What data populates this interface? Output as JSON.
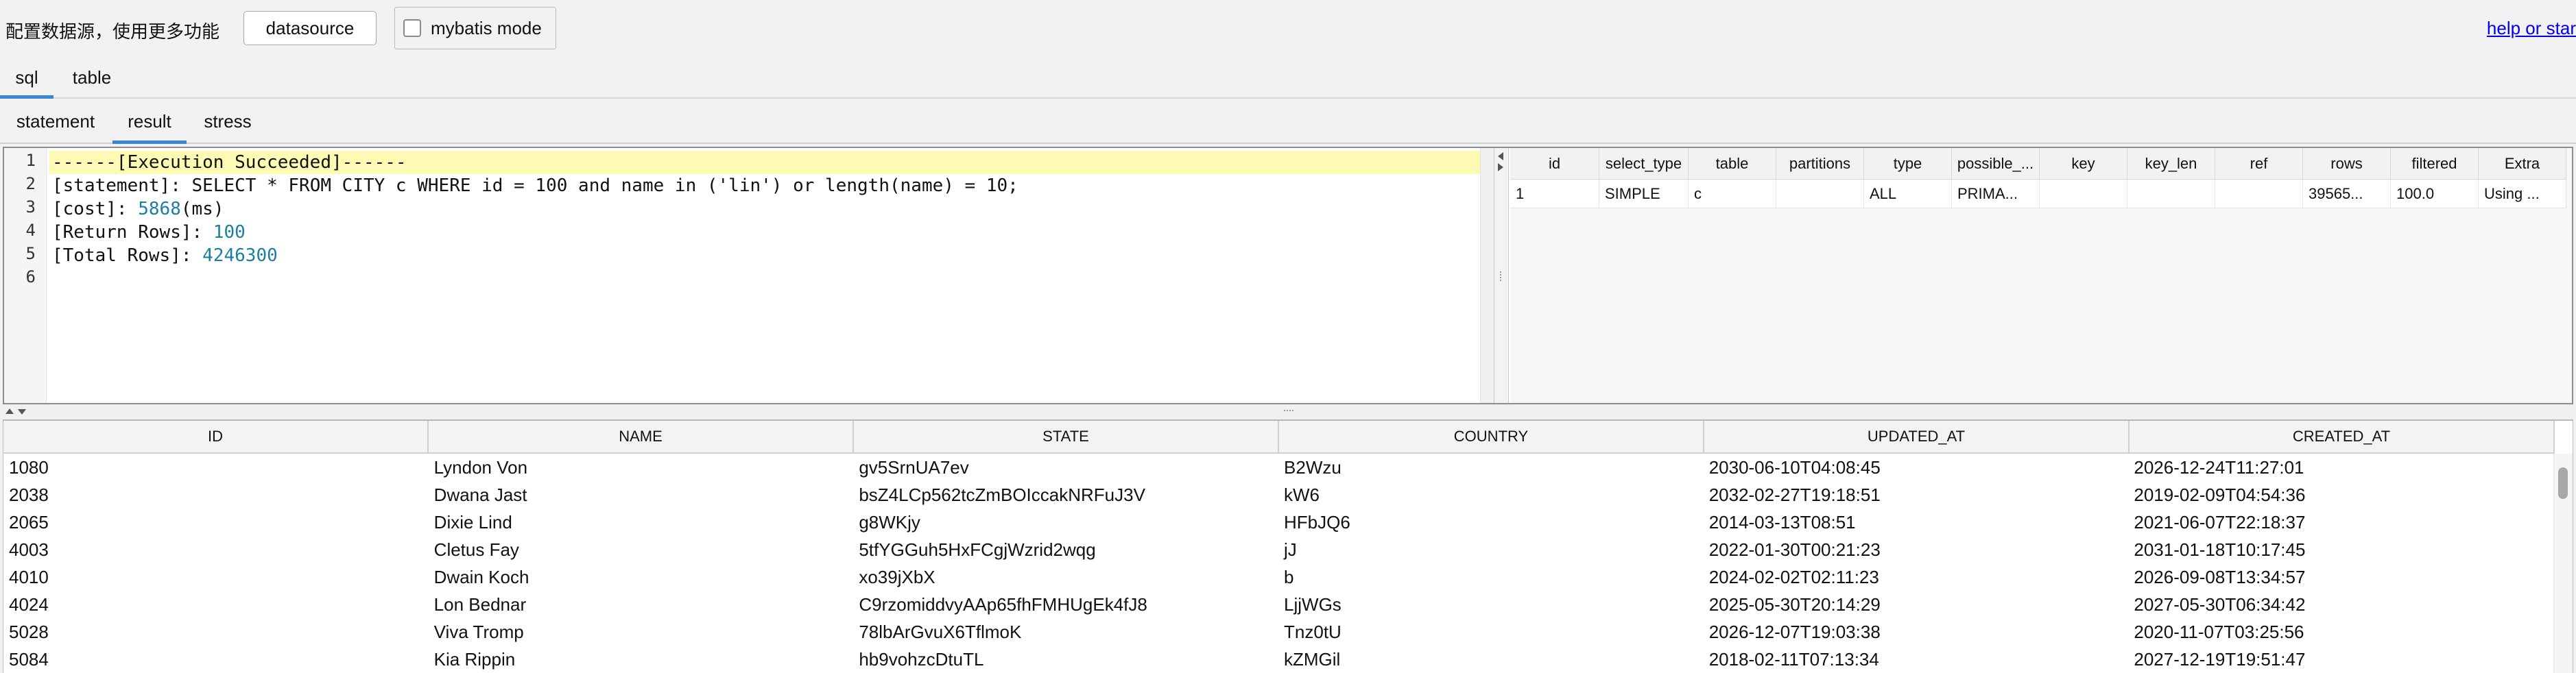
{
  "toolbar": {
    "label": "配置数据源，使用更多功能",
    "datasource_button": "datasource",
    "mybatis_label": "mybatis mode",
    "mybatis_checked": false,
    "help_link": "help or star"
  },
  "tabs_primary": [
    {
      "label": "sql",
      "active": true
    },
    {
      "label": "table",
      "active": false
    }
  ],
  "tabs_secondary": [
    {
      "label": "statement",
      "active": false
    },
    {
      "label": "result",
      "active": true
    },
    {
      "label": "stress",
      "active": false
    }
  ],
  "editor": {
    "line_numbers": [
      "1",
      "2",
      "3",
      "4",
      "5",
      "6"
    ],
    "lines": [
      {
        "key": "",
        "text": "------[Execution Succeeded]------"
      },
      {
        "key": "statement",
        "text": "SELECT * FROM CITY c WHERE id = 100 and name in ('lin') or length(name) = 10;"
      },
      {
        "key": "cost",
        "value": "5868",
        "unit": "(ms)"
      },
      {
        "key": "Return Rows",
        "value": "100"
      },
      {
        "key": "Total Rows",
        "value": "4246300"
      }
    ]
  },
  "explain": {
    "columns": [
      "id",
      "select_type",
      "table",
      "partitions",
      "type",
      "possible_...",
      "key",
      "key_len",
      "ref",
      "rows",
      "filtered",
      "Extra"
    ],
    "rows": [
      [
        "1",
        "SIMPLE",
        "c",
        "",
        "ALL",
        "PRIMA...",
        "",
        "",
        "",
        "39565...",
        "100.0",
        "Using ..."
      ]
    ]
  },
  "result": {
    "columns": [
      "ID",
      "NAME",
      "STATE",
      "COUNTRY",
      "UPDATED_AT",
      "CREATED_AT"
    ],
    "rows": [
      [
        "1080",
        "Lyndon Von",
        "gv5SrnUA7ev",
        "B2Wzu",
        "2030-06-10T04:08:45",
        "2026-12-24T11:27:01"
      ],
      [
        "2038",
        "Dwana Jast",
        "bsZ4LCp562tcZmBOIccakNRFuJ3V",
        "kW6",
        "2032-02-27T19:18:51",
        "2019-02-09T04:54:36"
      ],
      [
        "2065",
        "Dixie Lind",
        "g8WKjy",
        "HFbJQ6",
        "2014-03-13T08:51",
        "2021-06-07T22:18:37"
      ],
      [
        "4003",
        "Cletus Fay",
        "5tfYGGuh5HxFCgjWzrid2wqg",
        "jJ",
        "2022-01-30T00:21:23",
        "2031-01-18T10:17:45"
      ],
      [
        "4010",
        "Dwain Koch",
        "xo39jXbX",
        "b",
        "2024-02-02T02:11:23",
        "2026-09-08T13:34:57"
      ],
      [
        "4024",
        "Lon Bednar",
        "C9rzomiddvyAAp65fhFMHUgEk4fJ8",
        "LjjWGs",
        "2025-05-30T20:14:29",
        "2027-05-30T06:34:42"
      ],
      [
        "5028",
        "Viva Tromp",
        "78lbArGvuX6TflmoK",
        "Tnz0tU",
        "2026-12-07T19:03:38",
        "2020-11-07T03:25:56"
      ],
      [
        "5084",
        "Kia Rippin",
        "hb9vohzcDtuTL",
        "kZMGil",
        "2018-02-11T07:13:34",
        "2027-12-19T19:51:47"
      ]
    ]
  }
}
